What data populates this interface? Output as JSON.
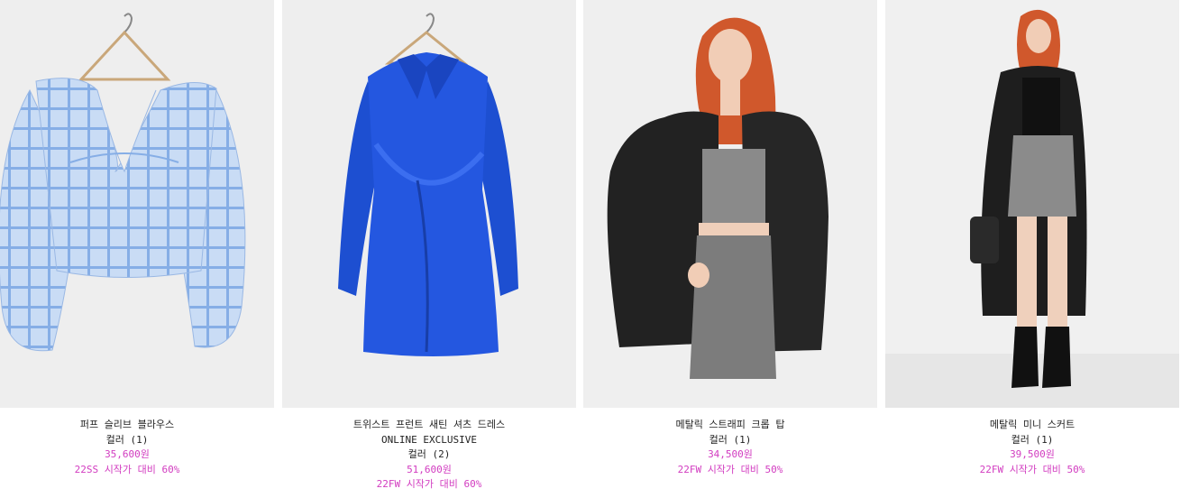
{
  "products": [
    {
      "name": "퍼프 슬리브 블라우스",
      "label": "",
      "colors": "컬러 (1)",
      "price": "35,600원",
      "promo": "22SS 시작가 대비 60%",
      "image_icon": "blouse-photo"
    },
    {
      "name": "트위스트 프런트 새틴 셔츠 드레스",
      "label": "ONLINE EXCLUSIVE",
      "colors": "컬러 (2)",
      "price": "51,600원",
      "promo": "22FW 시작가 대비 60%",
      "image_icon": "dress-photo"
    },
    {
      "name": "메탈릭 스트래피 크롭 탑",
      "label": "",
      "colors": "컬러 (1)",
      "price": "34,500원",
      "promo": "22FW 시작가 대비 50%",
      "image_icon": "crop-top-photo"
    },
    {
      "name": "메탈릭 미니 스커트",
      "label": "",
      "colors": "컬러 (1)",
      "price": "39,500원",
      "promo": "22FW 시작가 대비 50%",
      "image_icon": "mini-skirt-photo"
    }
  ],
  "colors": {
    "sale": "#d23cc0",
    "text": "#222222",
    "photo_bg": "#eeeeee"
  }
}
